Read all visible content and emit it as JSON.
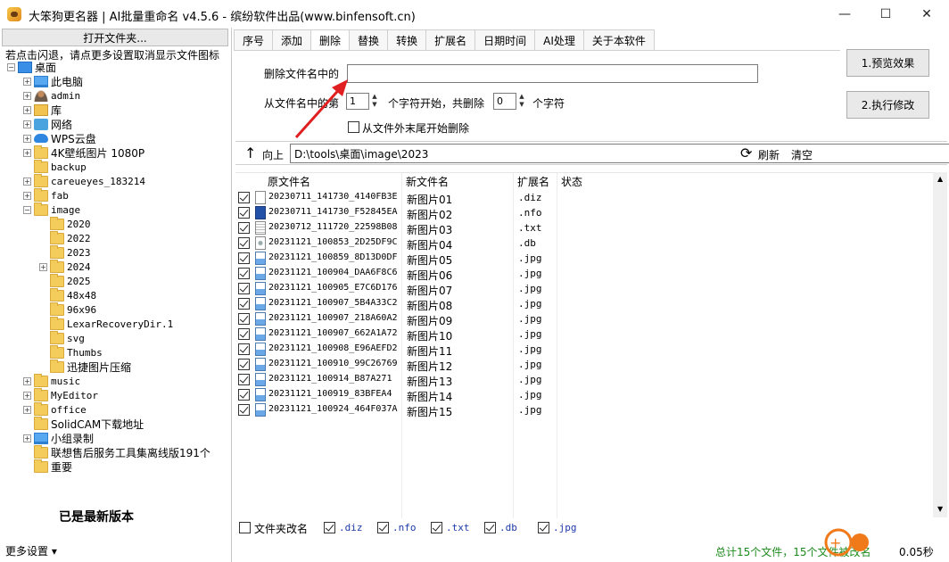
{
  "window": {
    "title": "大笨狗更名器 | AI批量重命名 v4.5.6 - 缤纷软件出品(www.binfensoft.cn)",
    "min": "—",
    "max": "☐",
    "close": "✕"
  },
  "left": {
    "open_folder": "打开文件夹...",
    "hint": "若点击闪退，请点更多设置取消显示文件图标",
    "latest": "已是最新版本",
    "more_settings": "更多设置 ▾",
    "tree": [
      {
        "label": "桌面",
        "icon": "desktop",
        "exp": "−",
        "indent": 0
      },
      {
        "label": "此电脑",
        "icon": "pc",
        "exp": "+",
        "indent": 1
      },
      {
        "label": "admin",
        "icon": "user",
        "exp": "+",
        "indent": 1
      },
      {
        "label": "库",
        "icon": "lib",
        "exp": "+",
        "indent": 1
      },
      {
        "label": "网络",
        "icon": "net",
        "exp": "+",
        "indent": 1
      },
      {
        "label": "WPS云盘",
        "icon": "cloud",
        "exp": "+",
        "indent": 1
      },
      {
        "label": "4K壁纸图片 1080P",
        "icon": "folder",
        "exp": "+",
        "indent": 1
      },
      {
        "label": "backup",
        "icon": "folder",
        "exp": "",
        "indent": 1
      },
      {
        "label": "careueyes_183214",
        "icon": "folder",
        "exp": "+",
        "indent": 1
      },
      {
        "label": "fab",
        "icon": "folder",
        "exp": "+",
        "indent": 1
      },
      {
        "label": "image",
        "icon": "folder",
        "exp": "−",
        "indent": 1
      },
      {
        "label": "2020",
        "icon": "folder",
        "exp": "",
        "indent": 2
      },
      {
        "label": "2022",
        "icon": "folder",
        "exp": "",
        "indent": 2
      },
      {
        "label": "2023",
        "icon": "folder",
        "exp": "",
        "indent": 2
      },
      {
        "label": "2024",
        "icon": "folder",
        "exp": "+",
        "indent": 2
      },
      {
        "label": "2025",
        "icon": "folder",
        "exp": "",
        "indent": 2
      },
      {
        "label": "48x48",
        "icon": "folder",
        "exp": "",
        "indent": 2
      },
      {
        "label": "96x96",
        "icon": "folder",
        "exp": "",
        "indent": 2
      },
      {
        "label": "LexarRecoveryDir.1",
        "icon": "folder",
        "exp": "",
        "indent": 2
      },
      {
        "label": "svg",
        "icon": "folder",
        "exp": "",
        "indent": 2
      },
      {
        "label": "Thumbs",
        "icon": "folder",
        "exp": "",
        "indent": 2
      },
      {
        "label": "迅捷图片压缩",
        "icon": "folder",
        "exp": "",
        "indent": 2
      },
      {
        "label": "music",
        "icon": "folder",
        "exp": "+",
        "indent": 1
      },
      {
        "label": "MyEditor",
        "icon": "folder",
        "exp": "+",
        "indent": 1
      },
      {
        "label": "office",
        "icon": "folder",
        "exp": "+",
        "indent": 1
      },
      {
        "label": "SolidCAM下载地址",
        "icon": "folder",
        "exp": "",
        "indent": 1
      },
      {
        "label": "小组录制",
        "icon": "pc",
        "exp": "+",
        "indent": 1
      },
      {
        "label": "联想售后服务工具集离线版191个",
        "icon": "folder",
        "exp": "",
        "indent": 1
      },
      {
        "label": "重要",
        "icon": "folder",
        "exp": "",
        "indent": 1
      }
    ]
  },
  "tabs": [
    "序号",
    "添加",
    "删除",
    "替换",
    "转换",
    "扩展名",
    "日期时间",
    "AI处理",
    "关于本软件"
  ],
  "active_tab": 2,
  "delete": {
    "name_label": "删除文件名中的",
    "name_value": "",
    "from_label": "从文件名中的第",
    "start_value": "1",
    "start_label": "个字符开始，共删除",
    "count_value": "0",
    "chars_label": "个字符",
    "from_end_label": "从文件外末尾开始删除"
  },
  "actions": {
    "preview": "1.预览效果",
    "execute": "2.执行修改"
  },
  "path": {
    "up": "向上",
    "value": "D:\\tools\\桌面\\image\\2023",
    "refresh": "刷新",
    "clear": "清空"
  },
  "columns": {
    "orig": "原文件名",
    "new": "新文件名",
    "ext": "扩展名",
    "status": "状态"
  },
  "files": [
    {
      "orig": "20230711_141730_4140FB3E",
      "new": "新图片01",
      "ext": ".diz",
      "type": "doc"
    },
    {
      "orig": "20230711_141730_F52845EA",
      "new": "新图片02",
      "ext": ".nfo",
      "type": "nfo"
    },
    {
      "orig": "20230712_111720_22598B08",
      "new": "新图片03",
      "ext": ".txt",
      "type": "txt"
    },
    {
      "orig": "20231121_100853_2D25DF9C",
      "new": "新图片04",
      "ext": ".db",
      "type": "db"
    },
    {
      "orig": "20231121_100859_8D13D0DF",
      "new": "新图片05",
      "ext": ".jpg",
      "type": "jpg"
    },
    {
      "orig": "20231121_100904_DAA6F8C6",
      "new": "新图片06",
      "ext": ".jpg",
      "type": "jpg"
    },
    {
      "orig": "20231121_100905_E7C6D176",
      "new": "新图片07",
      "ext": ".jpg",
      "type": "jpg"
    },
    {
      "orig": "20231121_100907_5B4A33C2",
      "new": "新图片08",
      "ext": ".jpg",
      "type": "jpg"
    },
    {
      "orig": "20231121_100907_218A60A2",
      "new": "新图片09",
      "ext": ".jpg",
      "type": "jpg"
    },
    {
      "orig": "20231121_100907_662A1A72",
      "new": "新图片10",
      "ext": ".jpg",
      "type": "jpg"
    },
    {
      "orig": "20231121_100908_E96AEFD2",
      "new": "新图片11",
      "ext": ".jpg",
      "type": "jpg"
    },
    {
      "orig": "20231121_100910_99C26769",
      "new": "新图片12",
      "ext": ".jpg",
      "type": "jpg"
    },
    {
      "orig": "20231121_100914_B87A271",
      "new": "新图片13",
      "ext": ".jpg",
      "type": "jpg"
    },
    {
      "orig": "20231121_100919_83BFEA4",
      "new": "新图片14",
      "ext": ".jpg",
      "type": "jpg"
    },
    {
      "orig": "20231121_100924_464F037A",
      "new": "新图片15",
      "ext": ".jpg",
      "type": "jpg"
    }
  ],
  "filters": {
    "folder_rename": "文件夹改名",
    "exts": [
      ".diz",
      ".nfo",
      ".txt",
      ".db",
      ".jpg"
    ]
  },
  "status": {
    "text": "总计15个文件，15个文件被改名",
    "speed": "0.05秒"
  },
  "colors": {
    "status_green": "#1c8a1c",
    "arrow_red": "#e02020",
    "watermark_orange": "#f07a1a"
  }
}
